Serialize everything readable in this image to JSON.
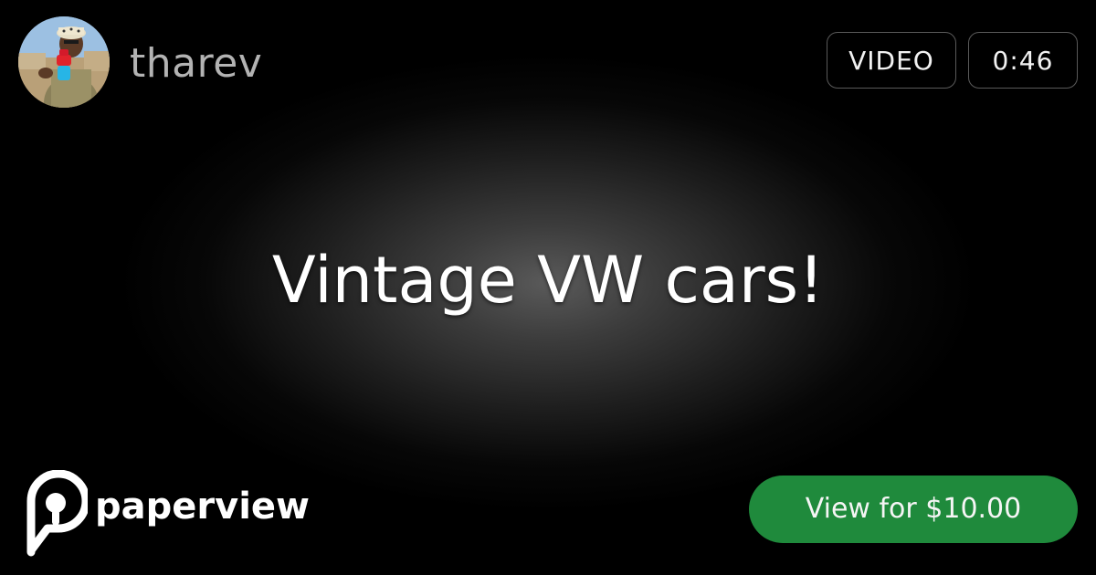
{
  "header": {
    "username": "tharev",
    "avatar_icon": "creator-avatar-photo"
  },
  "badges": {
    "type_label": "VIDEO",
    "duration": "0:46"
  },
  "content": {
    "title": "Vintage VW cars!"
  },
  "brand": {
    "name": "paperview",
    "logo_icon": "paperview-logo-icon"
  },
  "cta": {
    "label": "View for $10.00"
  },
  "colors": {
    "background": "#000000",
    "cta_green": "#1f8a3c",
    "badge_border": "#5a5a5a",
    "username_gray": "#b3b3b3"
  }
}
